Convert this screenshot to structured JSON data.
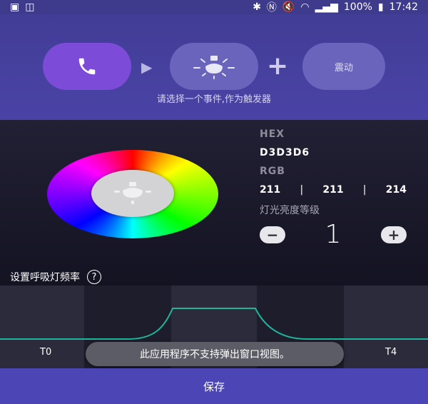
{
  "status_bar": {
    "battery": "100%",
    "time": "17:42"
  },
  "trigger": {
    "vibrate_label": "震动",
    "hint": "请选择一个事件,作为触发器"
  },
  "color": {
    "hex_label": "HEX",
    "hex_value": "D3D3D6",
    "rgb_label": "RGB",
    "r": "211",
    "g": "211",
    "b": "214",
    "brightness_label": "灯光亮度等级",
    "brightness_level": "1",
    "selected_color": "#d3d3d6"
  },
  "frequency": {
    "label": "设置呼吸灯频率",
    "t_start": "T0",
    "t_end": "T4"
  },
  "toast": "此应用程序不支持弹出窗口视图。",
  "save_label": "保存",
  "colors": {
    "accent": "#7c4bd8",
    "header_bg": "#4a43a6",
    "curve": "#1fb59a",
    "save_bg": "#4c45b5"
  }
}
